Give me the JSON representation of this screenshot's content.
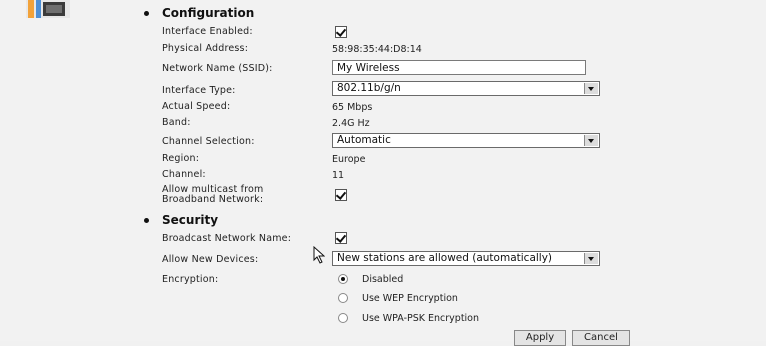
{
  "config": {
    "title": "Configuration",
    "interface_enabled_label": "Interface Enabled:",
    "physical_address_label": "Physical Address:",
    "physical_address": "58:98:35:44:D8:14",
    "ssid_label": "Network Name (SSID):",
    "ssid_value": "My Wireless",
    "interface_type_label": "Interface Type:",
    "interface_type_value": "802.11b/g/n",
    "actual_speed_label": "Actual Speed:",
    "actual_speed": "65 Mbps",
    "band_label": "Band:",
    "band": "2.4G Hz",
    "channel_selection_label": "Channel Selection:",
    "channel_selection_value": "Automatic",
    "region_label": "Region:",
    "region": "Europe",
    "channel_label": "Channel:",
    "channel": "11",
    "multicast_label_1": "Allow multicast from",
    "multicast_label_2": "Broadband Network:"
  },
  "security": {
    "title": "Security",
    "broadcast_label": "Broadcast Network Name:",
    "allow_devices_label": "Allow New Devices:",
    "allow_devices_value": "New stations are allowed (automatically)",
    "encryption_label": "Encryption:",
    "enc_disabled": "Disabled",
    "enc_wep": "Use WEP Encryption",
    "enc_wpa": "Use WPA-PSK Encryption"
  },
  "buttons": {
    "apply": "Apply",
    "cancel": "Cancel"
  }
}
